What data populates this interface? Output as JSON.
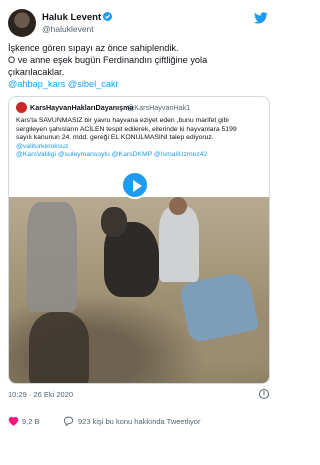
{
  "author": {
    "name": "Haluk Levent",
    "handle": "@haluklevent"
  },
  "tweet": {
    "lines": [
      "İşkence gören sıpayı az önce sahiplendik.",
      "O ve anne eşek bugün Ferdinandın çiftliğine yola",
      "çıkarılacaklar."
    ],
    "mentions": [
      "@ahbap_kars",
      "@sibel_cakr"
    ]
  },
  "quoted": {
    "name": "KarsHayvanHaklarıDayanışma",
    "handle": "@KarsHayvanHak1",
    "lines": [
      "Kars'ta SAVUNMASIZ bir yavru hayvana eziyet eden ,bunu marifet gibi",
      "sergileyen şahısların ACİLEN tespit edilerek, ellerinde ki hayvanlara 5199",
      "sayılı kanunun 24. mdd. gereği EL KONULMASINI talep ediyoruz.",
      "@valiturkeroksuz",
      "@KarsValiligi @suleymansoylu @KarsDKMP @IsmailUzmez42"
    ]
  },
  "meta": {
    "timestamp": "10:29 · 26 Eki 2020"
  },
  "actions": {
    "like_count": "9,2 B",
    "reply_text": "923 kişi bu konu hakkında Tweetliyor"
  },
  "colors": {
    "accent": "#1d9bf0",
    "text": "#0f1419",
    "secondary": "#536471",
    "like": "#f91880",
    "border": "#cfd9de"
  },
  "icons": [
    "verified-icon",
    "twitter-bird-icon",
    "play-icon",
    "info-icon",
    "heart-icon",
    "reply-icon"
  ]
}
